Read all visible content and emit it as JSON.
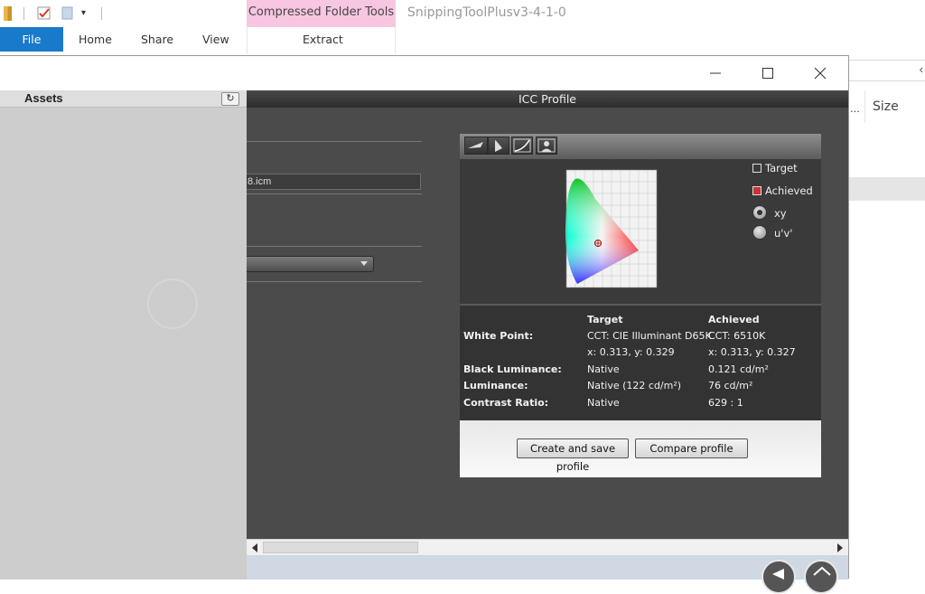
{
  "explorer": {
    "title": "SnippingToolPlusv3-4-1-0",
    "context_tab_group": "Compressed Folder Tools",
    "tabs": [
      {
        "label": "File"
      },
      {
        "label": "Home"
      },
      {
        "label": "Share"
      },
      {
        "label": "View"
      },
      {
        "label": "Extract"
      }
    ],
    "column_size_label": "Size",
    "truncated_column": "..."
  },
  "window": {
    "controls": [
      "minimize",
      "maximize",
      "close"
    ]
  },
  "assets": {
    "title": "Assets",
    "refresh_icon": "refresh-icon"
  },
  "app": {
    "header": "ICC Profile",
    "profile_field_value": "8.icm"
  },
  "icc": {
    "toolbar_icons": [
      "gamut-tilt-icon",
      "gamut-cie-icon",
      "curve-icon",
      "person-icon"
    ],
    "legend": {
      "target": "Target",
      "achieved": "Achieved"
    },
    "space_options": [
      {
        "label": "xy",
        "selected": true
      },
      {
        "label": "u'v'",
        "selected": false
      }
    ],
    "table": {
      "col_target": "Target",
      "col_achieved": "Achieved",
      "rows": [
        {
          "label": "White Point:",
          "target": "CCT: CIE Illuminant D65K",
          "achieved": "CCT: 6510K"
        },
        {
          "label": "",
          "target": "x: 0.313, y: 0.329",
          "achieved": "x: 0.313, y: 0.327"
        },
        {
          "label": "Black Luminance:",
          "target": "Native",
          "achieved": "0.121 cd/m²"
        },
        {
          "label": "Luminance:",
          "target": "Native (122 cd/m²)",
          "achieved": "76 cd/m²"
        },
        {
          "label": "Contrast Ratio:",
          "target": "Native",
          "achieved": "629 : 1"
        }
      ]
    },
    "buttons": {
      "create": "Create and save profile",
      "compare": "Compare profile"
    }
  },
  "colors": {
    "file_tab": "#1979ca",
    "context_tab": "#f7c6e1",
    "panel_dark": "#333333",
    "app_bg": "#4b4b4b"
  }
}
